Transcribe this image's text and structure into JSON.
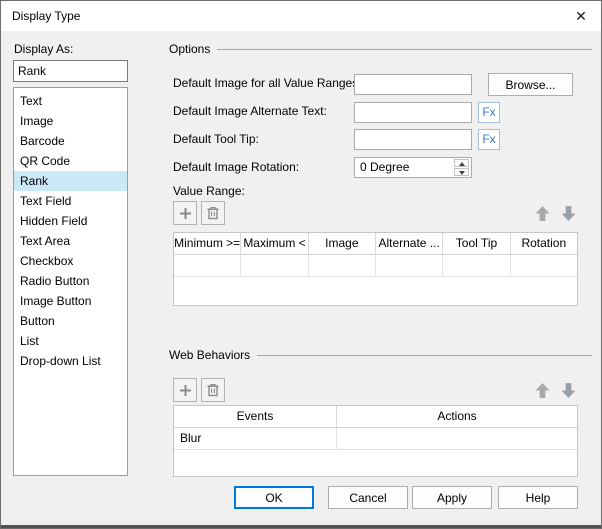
{
  "window": {
    "title": "Display Type",
    "close_icon": "✕"
  },
  "left_panel": {
    "label": "Display As:",
    "value": "Rank",
    "selected_index": 4,
    "items": [
      "Text",
      "Image",
      "Barcode",
      "QR Code",
      "Rank",
      "Text Field",
      "Hidden Field",
      "Text Area",
      "Checkbox",
      "Radio Button",
      "Image Button",
      "Button",
      "List",
      "Drop-down List"
    ]
  },
  "options": {
    "title": "Options",
    "default_image_label": "Default Image for all Value Ranges:",
    "default_image_value": "",
    "browse_label": "Browse...",
    "alt_text_label": "Default Image Alternate Text:",
    "alt_text_value": "",
    "fx_label": "Fx",
    "tooltip_label": "Default Tool Tip:",
    "tooltip_value": "",
    "rotation_label": "Default Image Rotation:",
    "rotation_value": "0 Degree",
    "value_range_label": "Value Range:",
    "value_range_table": {
      "columns": [
        "Minimum >=",
        "Maximum <",
        "Image",
        "Alternate ...",
        "Tool Tip",
        "Rotation"
      ],
      "rows": [
        [
          "",
          "",
          "",
          "",
          "",
          ""
        ]
      ]
    }
  },
  "web_behaviors": {
    "title": "Web Behaviors",
    "table": {
      "columns": [
        "Events",
        "Actions"
      ],
      "rows": [
        [
          "Blur",
          ""
        ]
      ]
    }
  },
  "footer": {
    "ok": "OK",
    "cancel": "Cancel",
    "apply": "Apply",
    "help": "Help"
  },
  "colors": {
    "selection": "#cbe8f6",
    "accent": "#0078d7",
    "fx_blue": "#3579d8",
    "dialog_bg": "#f0f0f0",
    "titlebar_bg": "#ffffff"
  }
}
